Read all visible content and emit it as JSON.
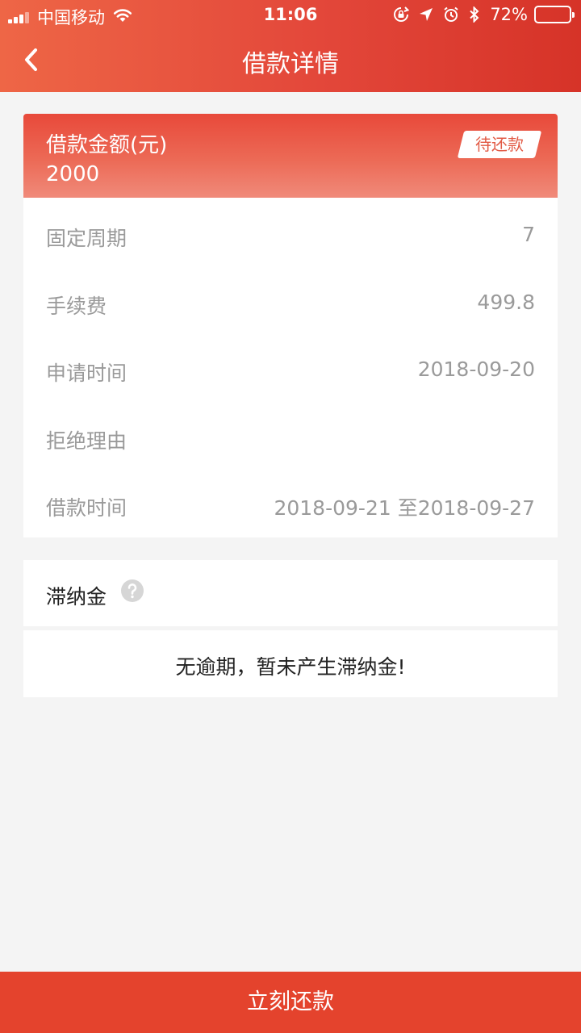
{
  "status_bar": {
    "carrier": "中国移动",
    "time": "11:06",
    "battery": "72%",
    "battery_level": 0.72
  },
  "nav": {
    "title": "借款详情"
  },
  "loan": {
    "amount_label": "借款金额(元)",
    "amount": "2000",
    "status": "待还款"
  },
  "details": [
    {
      "label": "固定周期",
      "value": "7"
    },
    {
      "label": "手续费",
      "value": "499.8"
    },
    {
      "label": "申请时间",
      "value": "2018-09-20"
    },
    {
      "label": "拒绝理由",
      "value": ""
    },
    {
      "label": "借款时间",
      "value": "2018-09-21 至2018-09-27"
    }
  ],
  "late_fee": {
    "title": "滞纳金",
    "message": "无逾期，暂未产生滞纳金!"
  },
  "action": {
    "repay_label": "立刻还款"
  },
  "colors": {
    "brand": "#e4432d",
    "background": "#f4f4f4",
    "muted_text": "#9a9a9a"
  }
}
